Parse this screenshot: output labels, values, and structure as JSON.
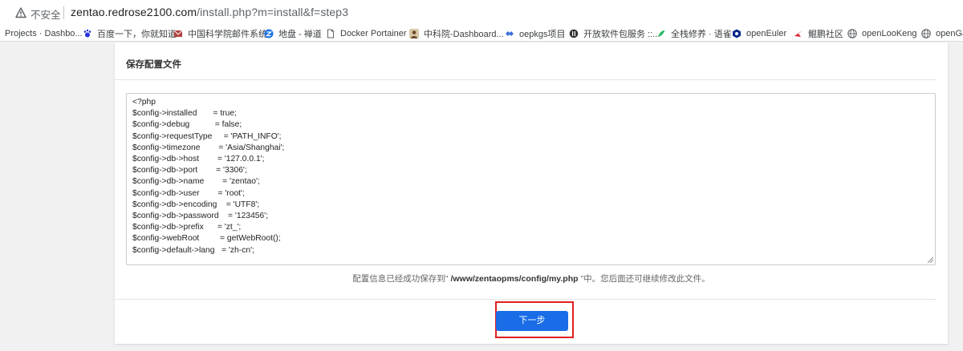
{
  "browser": {
    "security_label": "不安全",
    "url_host": "zentao.redrose2100.com",
    "url_path": "/install.php?m=install&f=step3"
  },
  "bookmarks": [
    {
      "label": "Projects · Dashbo...",
      "icon": "none"
    },
    {
      "label": "百度一下，你就知道",
      "icon": "baidu-icon"
    },
    {
      "label": "中国科学院邮件系统",
      "icon": "cas-mail-icon"
    },
    {
      "label": "地盘 - 禅道",
      "icon": "zentao-icon"
    },
    {
      "label": "Docker Portainer",
      "icon": "file-icon"
    },
    {
      "label": "中科院-Dashboard...",
      "icon": "avatar-icon"
    },
    {
      "label": "oepkgs项目",
      "icon": "oepkgs-icon"
    },
    {
      "label": "开放软件包服务 ::...",
      "icon": "package-icon"
    },
    {
      "label": "全栈修养 · 语雀",
      "icon": "yuque-icon"
    },
    {
      "label": "openEuler",
      "icon": "openeuler-icon"
    },
    {
      "label": "鲲鹏社区",
      "icon": "kunpeng-icon"
    },
    {
      "label": "openLooKeng",
      "icon": "globe-icon"
    },
    {
      "label": "openGa",
      "icon": "globe-icon"
    }
  ],
  "card": {
    "title": "保存配置文件",
    "config_lines": [
      "<?php",
      "$config->installed       = true;",
      "$config->debug           = false;",
      "$config->requestType     = 'PATH_INFO';",
      "$config->timezone        = 'Asia/Shanghai';",
      "$config->db->host        = '127.0.0.1';",
      "$config->db->port        = '3306';",
      "$config->db->name        = 'zentao';",
      "$config->db->user        = 'root';",
      "$config->db->encoding    = 'UTF8';",
      "$config->db->password    = '123456';",
      "$config->db->prefix      = 'zt_';",
      "$config->webRoot         = getWebRoot();",
      "$config->default->lang   = 'zh-cn';"
    ],
    "note_prefix": "配置信息已经成功保存到\" ",
    "note_path": "/www/zentaopms/config/my.php",
    "note_suffix": " \"中。您后面还可继续修改此文件。",
    "next_label": "下一步"
  },
  "colors": {
    "primary": "#1a6ce7",
    "highlight_border": "#e02020"
  }
}
